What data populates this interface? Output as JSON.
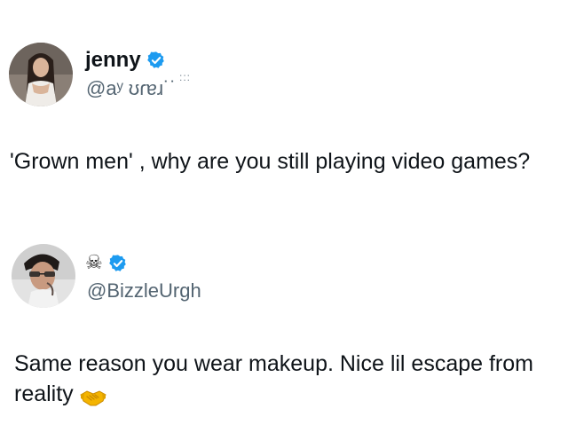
{
  "tweets": [
    {
      "display_name": "jenny",
      "handle": "@aʸ ʊɾɐɹ˙˙",
      "handle_decoration": ":::",
      "verified": true,
      "text": "'Grown men' , why are you still playing video games?",
      "avatar_icon": "woman-portrait-avatar"
    },
    {
      "display_name": "☠",
      "handle": "@BizzleUrgh",
      "verified": true,
      "text": "Same reason you wear makeup. Nice lil escape from reality",
      "trailing_emoji": "handshake-icon",
      "avatar_icon": "man-portrait-avatar"
    }
  ],
  "colors": {
    "verified": "#1d9bf0",
    "text": "#0f1419",
    "secondary_text": "#536471",
    "handshake": "#f4b400"
  }
}
